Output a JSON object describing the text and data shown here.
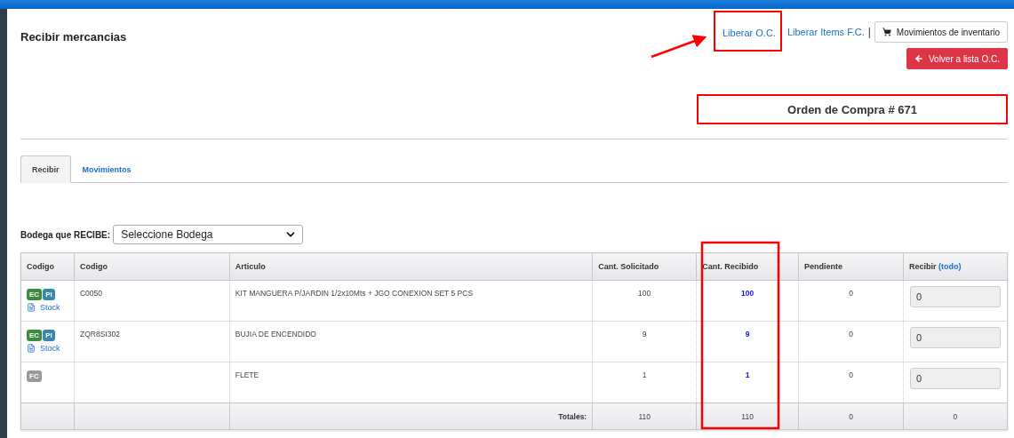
{
  "page": {
    "title": "Recibir mercancias"
  },
  "header_links": [
    {
      "label": "Liberar O.C."
    },
    {
      "label": "Liberar Items F.C."
    }
  ],
  "separator": "|",
  "buttons": [
    {
      "label": "Movimientos de inventario",
      "kind": "default"
    },
    {
      "label": "Volver a lista O.C.",
      "kind": "danger"
    }
  ],
  "order_title": "Orden de Compra # 671",
  "tabs": [
    {
      "label": "Recibir",
      "selected": true
    },
    {
      "label": "Movimientos",
      "selected": false
    }
  ],
  "warehouse": {
    "label": "Bodega que RECIBE:",
    "placeholder": "Seleccione Bodega"
  },
  "table": {
    "columns": [
      {
        "label": "Codigo"
      },
      {
        "label": "Codigo"
      },
      {
        "label": "Articulo"
      },
      {
        "label": "Cant. Solicitado"
      },
      {
        "label": "Cant. Recibido"
      },
      {
        "label": "Pendiente"
      },
      {
        "label": "Recibir",
        "link": "(todo)"
      }
    ],
    "rows": [
      {
        "badges": [
          {
            "label": "EC",
            "color": "#3c8c3f"
          },
          {
            "label": "PI",
            "color": "#3a87ad"
          }
        ],
        "stock_link": "Stock",
        "code": "C0050",
        "article": "KIT MANGUERA P/JARDIN 1/2x10Mts + JGO CONEXION SET 5 PCS",
        "requested": "100",
        "received": "100",
        "pending": "0",
        "receive": {
          "value": "0",
          "disabled": true
        }
      },
      {
        "badges": [
          {
            "label": "EC",
            "color": "#3c8c3f"
          },
          {
            "label": "PI",
            "color": "#3a87ad"
          }
        ],
        "stock_link": "Stock",
        "code": "ZQR8SI302",
        "article": "BUJIA DE ENCENDIDO",
        "requested": "9",
        "received": "9",
        "pending": "0",
        "receive": {
          "value": "0",
          "disabled": true
        }
      },
      {
        "badges": [
          {
            "label": "FC",
            "color": "#999999"
          }
        ],
        "article": "FLETE",
        "requested": "1",
        "received": "1",
        "pending": "0",
        "receive": {
          "value": "0",
          "disabled": true
        }
      }
    ],
    "totals": {
      "label": "Totales:",
      "requested": "110",
      "received": "110",
      "pending": "0",
      "receive": "0"
    }
  }
}
